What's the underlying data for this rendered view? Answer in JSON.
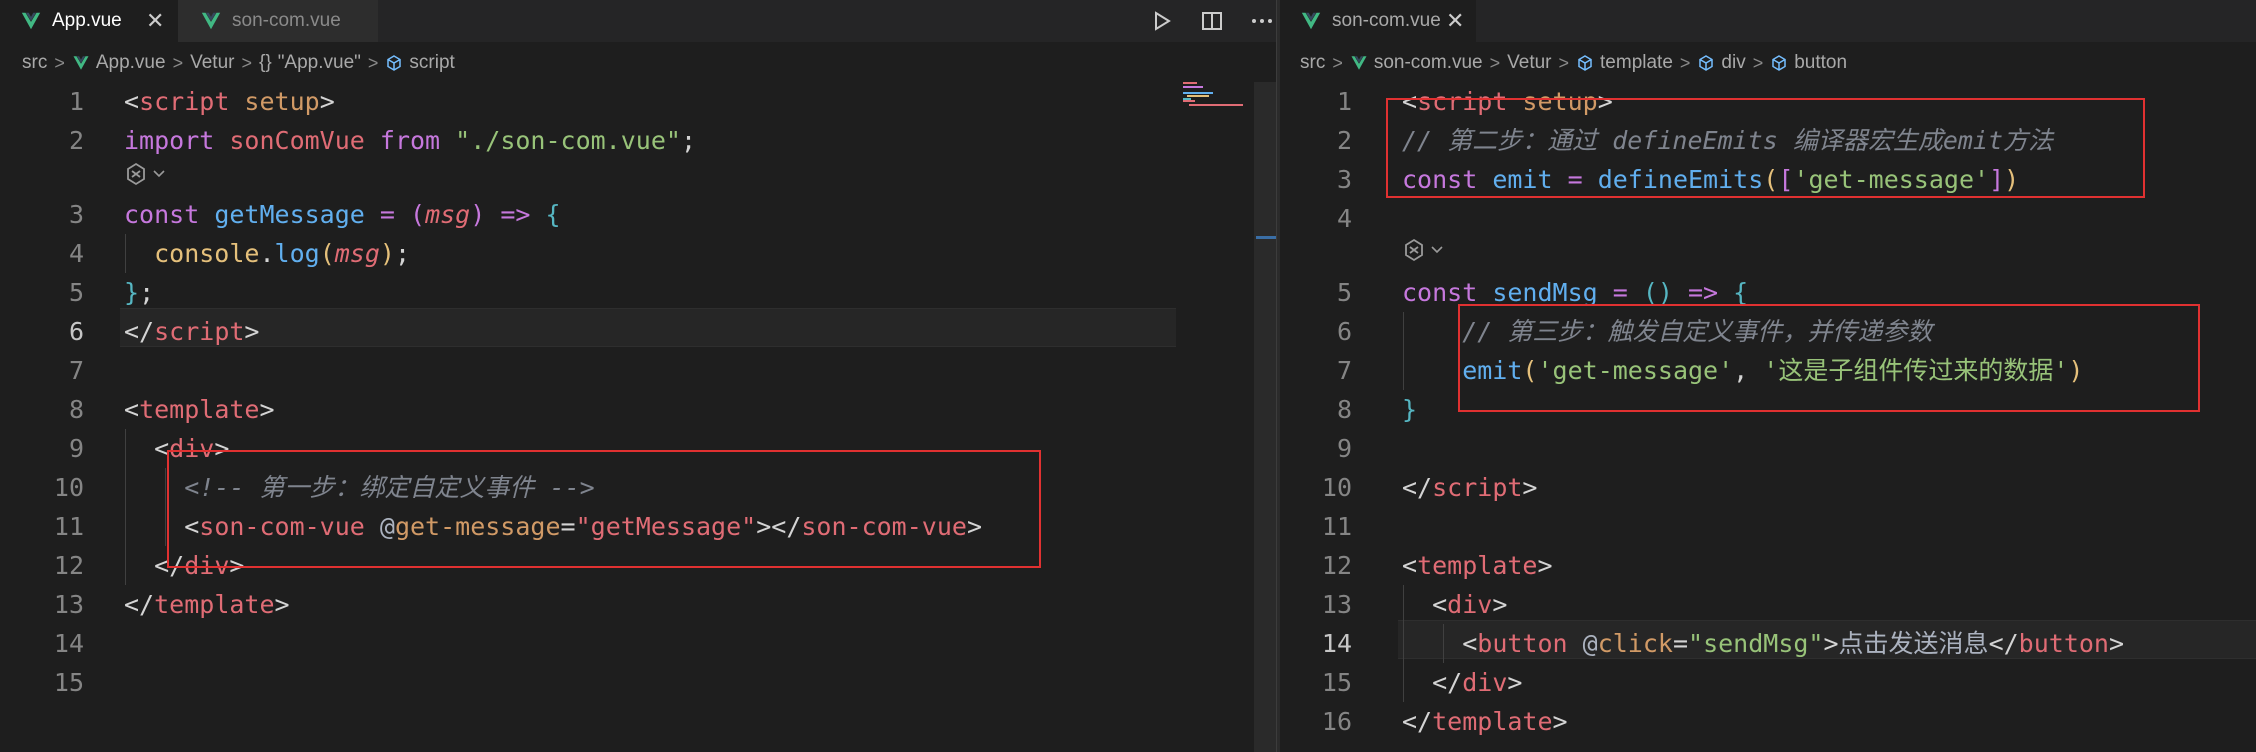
{
  "left": {
    "tabs": [
      {
        "label": "App.vue",
        "active": true
      },
      {
        "label": "son-com.vue",
        "active": false
      }
    ],
    "breadcrumb": [
      "src",
      "App.vue",
      "Vetur",
      "\"App.vue\"",
      "script"
    ],
    "line_numbers": [
      "1",
      "2",
      "3",
      "4",
      "5",
      "6",
      "7",
      "8",
      "9",
      "10",
      "11",
      "12",
      "13",
      "14",
      "15"
    ],
    "current_line": "6",
    "code": {
      "l1": [
        "<",
        "script",
        " setup",
        ">"
      ],
      "l2": [
        "import",
        " sonComVue ",
        "from",
        " \"./son-com.vue\"",
        ";"
      ],
      "l3": [
        "const",
        " getMessage",
        " = ",
        "(",
        "msg",
        ")",
        " => ",
        "{"
      ],
      "l4": [
        "  console",
        ".",
        "log",
        "(",
        "msg",
        ")",
        ";"
      ],
      "l5": [
        "}",
        ";"
      ],
      "l6": [
        "</",
        "script",
        ">"
      ],
      "l8": [
        "<",
        "template",
        ">"
      ],
      "l9": [
        "  <",
        "div",
        ">"
      ],
      "l10": [
        "    <!-- 第一步：绑定自定义事件 -->"
      ],
      "l11": [
        "    <",
        "son-com-vue",
        " @",
        "get-message",
        "=",
        "\"getMessage\"",
        "></",
        "son-com-vue",
        ">"
      ],
      "l12": [
        "  </",
        "div",
        ">"
      ],
      "l13": [
        "</",
        "template",
        ">"
      ]
    }
  },
  "right": {
    "tabs": [
      {
        "label": "son-com.vue",
        "active": true
      }
    ],
    "breadcrumb": [
      "src",
      "son-com.vue",
      "Vetur",
      "template",
      "div",
      "button"
    ],
    "line_numbers": [
      "1",
      "2",
      "3",
      "4",
      "5",
      "6",
      "7",
      "8",
      "9",
      "10",
      "11",
      "12",
      "13",
      "14",
      "15",
      "16"
    ],
    "current_line": "14",
    "code": {
      "l1": [
        "<",
        "script",
        " setup",
        ">"
      ],
      "l2": [
        "// 第二步：通过 defineEmits 编译器宏生成emit方法"
      ],
      "l3": [
        "const",
        " emit",
        " = ",
        "defineEmits",
        "(",
        "[",
        "'get-message'",
        "]",
        ")"
      ],
      "l5": [
        "const",
        " sendMsg",
        " = ",
        "()",
        " => ",
        "{"
      ],
      "l6": [
        "    // 第三步：触发自定义事件，并传递参数"
      ],
      "l7": [
        "    emit",
        "(",
        "'get-message'",
        ", ",
        "'这是子组件传过来的数据'",
        ")"
      ],
      "l8": [
        "}"
      ],
      "l10": [
        "</",
        "script",
        ">"
      ],
      "l12": [
        "<",
        "template",
        ">"
      ],
      "l13": [
        "  <",
        "div",
        ">"
      ],
      "l14": [
        "    <",
        "button",
        " @",
        "click",
        "=",
        "\"sendMsg\"",
        ">",
        "点击发送消息",
        "</",
        "button",
        ">"
      ],
      "l15": [
        "  </",
        "div",
        ">"
      ],
      "l16": [
        "</",
        "template",
        ">"
      ]
    }
  },
  "colors": {
    "highlight_box": "#e03131",
    "vue_green": "#41b883",
    "editor_bg": "#1e1e1e"
  },
  "icons": [
    "vue-logo-icon",
    "close-icon",
    "run-icon",
    "split-editor-icon",
    "more-actions-icon",
    "braces-icon",
    "cube-icon",
    "codelens-icon",
    "chevron-down-icon"
  ]
}
